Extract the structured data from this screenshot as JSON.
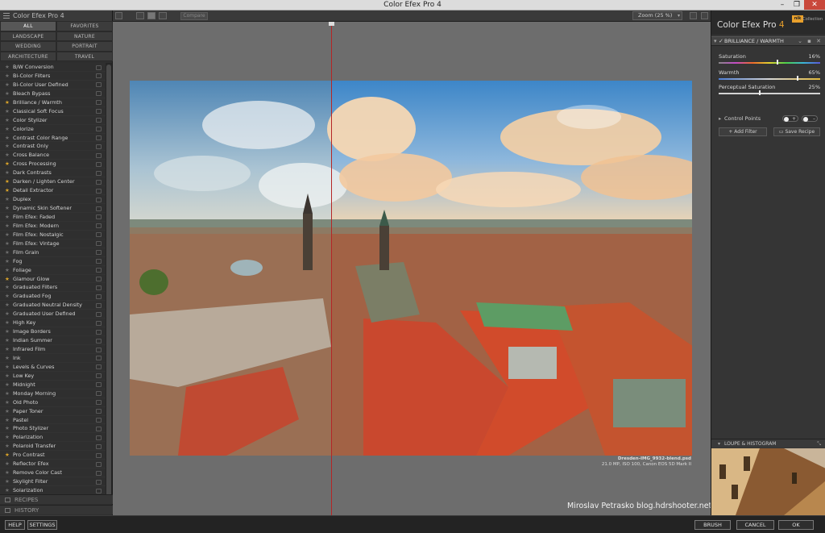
{
  "window": {
    "title": "Color Efex Pro 4"
  },
  "left_panel": {
    "brand": "Color Efex Pro 4",
    "categories": [
      "ALL",
      "FAVORITES",
      "LANDSCAPE",
      "NATURE",
      "WEDDING",
      "PORTRAIT",
      "ARCHITECTURE",
      "TRAVEL"
    ],
    "active_category": "ALL",
    "filters": [
      {
        "label": "B/W Conversion",
        "fav": false
      },
      {
        "label": "Bi-Color Filters",
        "fav": false
      },
      {
        "label": "Bi-Color User Defined",
        "fav": false
      },
      {
        "label": "Bleach Bypass",
        "fav": false
      },
      {
        "label": "Brilliance / Warmth",
        "fav": true
      },
      {
        "label": "Classical Soft Focus",
        "fav": false
      },
      {
        "label": "Color Stylizer",
        "fav": false
      },
      {
        "label": "Colorize",
        "fav": false
      },
      {
        "label": "Contrast Color Range",
        "fav": false
      },
      {
        "label": "Contrast Only",
        "fav": false
      },
      {
        "label": "Cross Balance",
        "fav": false
      },
      {
        "label": "Cross Processing",
        "fav": true
      },
      {
        "label": "Dark Contrasts",
        "fav": false
      },
      {
        "label": "Darken / Lighten Center",
        "fav": true
      },
      {
        "label": "Detail Extractor",
        "fav": true
      },
      {
        "label": "Duplex",
        "fav": false
      },
      {
        "label": "Dynamic Skin Softener",
        "fav": false
      },
      {
        "label": "Film Efex: Faded",
        "fav": false
      },
      {
        "label": "Film Efex: Modern",
        "fav": false
      },
      {
        "label": "Film Efex: Nostalgic",
        "fav": false
      },
      {
        "label": "Film Efex: Vintage",
        "fav": false
      },
      {
        "label": "Film Grain",
        "fav": false
      },
      {
        "label": "Fog",
        "fav": false
      },
      {
        "label": "Foliage",
        "fav": false
      },
      {
        "label": "Glamour Glow",
        "fav": true
      },
      {
        "label": "Graduated Filters",
        "fav": false
      },
      {
        "label": "Graduated Fog",
        "fav": false
      },
      {
        "label": "Graduated Neutral Density",
        "fav": false
      },
      {
        "label": "Graduated User Defined",
        "fav": false
      },
      {
        "label": "High Key",
        "fav": false
      },
      {
        "label": "Image Borders",
        "fav": false
      },
      {
        "label": "Indian Summer",
        "fav": false
      },
      {
        "label": "Infrared Film",
        "fav": false
      },
      {
        "label": "Ink",
        "fav": false
      },
      {
        "label": "Levels & Curves",
        "fav": false
      },
      {
        "label": "Low Key",
        "fav": false
      },
      {
        "label": "Midnight",
        "fav": false
      },
      {
        "label": "Monday Morning",
        "fav": false
      },
      {
        "label": "Old Photo",
        "fav": false
      },
      {
        "label": "Paper Toner",
        "fav": false
      },
      {
        "label": "Pastel",
        "fav": false
      },
      {
        "label": "Photo Stylizer",
        "fav": false
      },
      {
        "label": "Polarization",
        "fav": false
      },
      {
        "label": "Polaroid Transfer",
        "fav": false
      },
      {
        "label": "Pro Contrast",
        "fav": true
      },
      {
        "label": "Reflector Efex",
        "fav": false
      },
      {
        "label": "Remove Color Cast",
        "fav": false
      },
      {
        "label": "Skylight Filter",
        "fav": false
      },
      {
        "label": "Solarization",
        "fav": false
      }
    ],
    "sections": {
      "recipes": "RECIPES",
      "history": "HISTORY"
    }
  },
  "toolbar": {
    "compare_label": "Compare",
    "zoom_label": "Zoom (25 %)"
  },
  "canvas": {
    "caption_filename": "Dresden-IMG_9932-blend.psd",
    "caption_info": "21.0 MP, ISO 100, Canon EOS 5D Mark II",
    "watermark": "Miroslav Petrasko blog.hdrshooter.net"
  },
  "right_panel": {
    "brand_name": "Color Efex Pro",
    "brand_number": "4",
    "nik_badge": "nik",
    "nik_sub": "Collection",
    "filter_title": "BRILLIANCE / WARMTH",
    "sliders": [
      {
        "label": "Saturation",
        "value": "16%",
        "level": 0.58,
        "track": "sat"
      },
      {
        "label": "Warmth",
        "value": "65%",
        "level": 0.78,
        "track": "warm"
      },
      {
        "label": "Perceptual Saturation",
        "value": "25%",
        "level": 0.4,
        "track": "perc"
      }
    ],
    "control_points_label": "Control Points",
    "add_filter_label": "Add Filter",
    "save_recipe_label": "Save Recipe",
    "loupe_label": "LOUPE & HISTOGRAM"
  },
  "bottom_bar": {
    "help": "HELP",
    "settings": "SETTINGS",
    "brush": "BRUSH",
    "cancel": "CANCEL",
    "ok": "OK"
  },
  "colors": {
    "accent": "#e8a02c",
    "split_line": "#b52626",
    "favorite_star": "#d9a32a"
  }
}
